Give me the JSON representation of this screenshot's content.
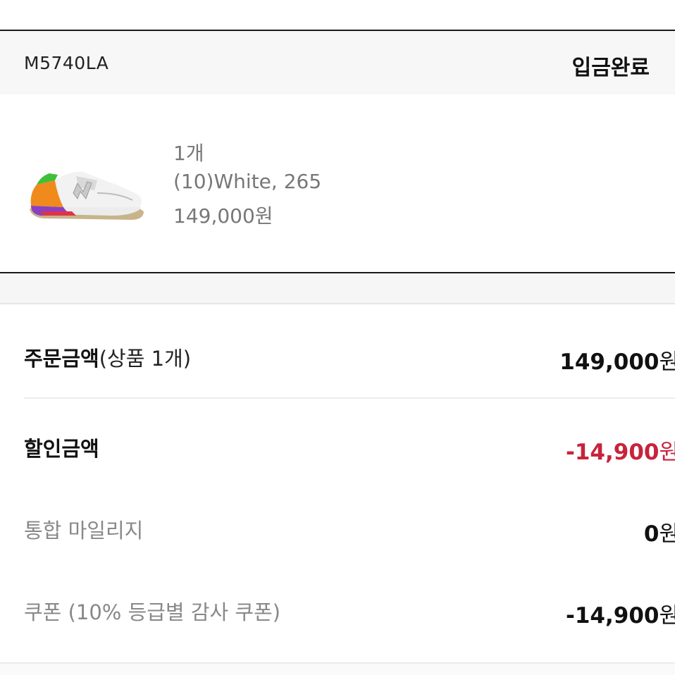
{
  "order": {
    "model_code": "M5740LA",
    "status": "입금완료"
  },
  "product": {
    "image_icon": "sneaker-thumbnail",
    "quantity": "1개",
    "option": "(10)White, 265",
    "price": "149,000원"
  },
  "summary": {
    "order_amount_label": "주문금액",
    "order_amount_detail": "(상품 1개)",
    "order_amount_number": "149,000",
    "order_amount_unit": "원",
    "discount_label": "할인금액",
    "discount_number": "-14,900",
    "discount_unit": "원",
    "mileage_label": "통합 마일리지",
    "mileage_number": "0",
    "mileage_unit": "원",
    "coupon_label": "쿠폰 (10% 등급별 감사 쿠폰)",
    "coupon_number": "-14,900",
    "coupon_unit": "원"
  },
  "colors": {
    "discount_red": "#c8233c",
    "header_bg": "#f7f7f7"
  }
}
